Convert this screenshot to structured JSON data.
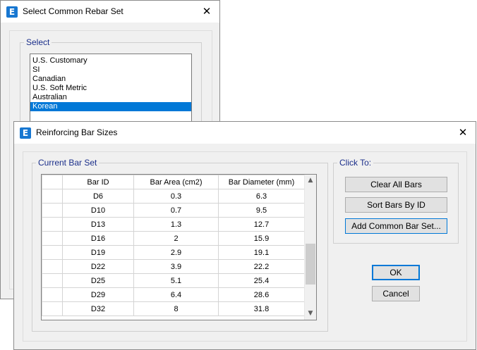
{
  "rebar_dialog": {
    "title": "Select Common Rebar Set",
    "group_label": "Select",
    "items": [
      "U.S. Customary",
      "SI",
      "Canadian",
      "U.S. Soft Metric",
      "Australian",
      "Korean"
    ],
    "selected": "Korean"
  },
  "sizes_dialog": {
    "title": "Reinforcing Bar Sizes",
    "current_set_label": "Current Bar Set",
    "columns": [
      "Bar ID",
      "Bar Area  (cm2)",
      "Bar Diameter  (mm)"
    ],
    "rows": [
      [
        "D6",
        "0.3",
        "6.3"
      ],
      [
        "D10",
        "0.7",
        "9.5"
      ],
      [
        "D13",
        "1.3",
        "12.7"
      ],
      [
        "D16",
        "2",
        "15.9"
      ],
      [
        "D19",
        "2.9",
        "19.1"
      ],
      [
        "D22",
        "3.9",
        "22.2"
      ],
      [
        "D25",
        "5.1",
        "25.4"
      ],
      [
        "D29",
        "6.4",
        "28.6"
      ],
      [
        "D32",
        "8",
        "31.8"
      ]
    ],
    "click_to_label": "Click To:",
    "clear_all_label": "Clear All Bars",
    "sort_label": "Sort Bars By ID",
    "add_common_label": "Add Common Bar Set...",
    "ok_label": "OK",
    "cancel_label": "Cancel"
  },
  "app_icon_glyph": "E",
  "close_glyph": "✕",
  "scroll_up_glyph": "▲",
  "scroll_down_glyph": "▼"
}
